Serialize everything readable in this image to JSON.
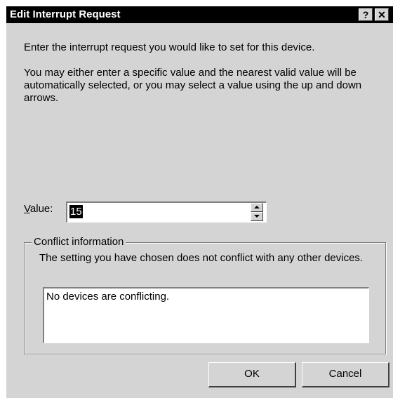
{
  "window": {
    "title": "Edit Interrupt Request",
    "help_label": "?",
    "close_label": "✕"
  },
  "main": {
    "instruction": "Enter the interrupt request you would like to set for this device.",
    "description": "You may either enter a specific value and the nearest valid value will be automatically selected, or you may select a value using the up and down arrows."
  },
  "value_field": {
    "label_mnemonic": "V",
    "label_rest": "alue:",
    "value": "15"
  },
  "conflict": {
    "title": "Conflict information",
    "message": "The setting you have chosen does not conflict with any other devices.",
    "list_items": [
      "No devices are conflicting."
    ]
  },
  "buttons": {
    "ok": "OK",
    "cancel": "Cancel"
  }
}
